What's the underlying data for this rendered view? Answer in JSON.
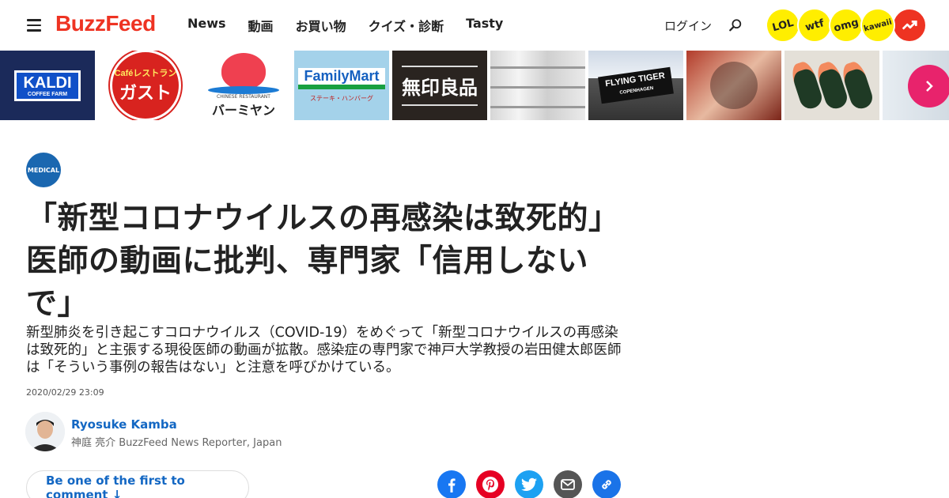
{
  "header": {
    "logo": "BuzzFeed",
    "nav": [
      "News",
      "動画",
      "お買い物",
      "クイズ・診断",
      "Tasty"
    ],
    "login": "ログイン",
    "badges": [
      "LOL",
      "wtf",
      "omg",
      "kawaii"
    ]
  },
  "strip": {
    "kaldi_main": "KALDI",
    "kaldi_sub": "COFFEE FARM",
    "gusto_small": "Caféレストラン",
    "gusto_big": "ガスト",
    "bamiyan_sub": "CHINESE RESTAURANT",
    "bamiyan_name": "バーミヤン",
    "familymart": "FamilyMart",
    "familymart_under": "ステーキ・ハンバーグ",
    "muji": "無印良品",
    "flying_tiger": "FLYING TIGER",
    "flying_tiger_sub": "COPENHAGEN"
  },
  "article": {
    "badge": "MEDICAL",
    "title": "「新型コロナウイルスの再感染は致死的」医師の動画に批判、専門家「信用しないで」",
    "description": "新型肺炎を引き起こすコロナウイルス（COVID-19）をめぐって「新型コロナウイルスの再感染は致死的」と主張する現役医師の動画が拡散。感染症の専門家で神戸大学教授の岩田健太郎医師は「そういう事例の報告はない」と注意を呼びかけている。",
    "date": "2020/02/29 23:09",
    "author_name": "Ryosuke Kamba",
    "author_role": "神庭 亮介 BuzzFeed News Reporter, Japan",
    "comment_label": "Be one of the first to comment ↓"
  },
  "colors": {
    "brand": "#ee3322",
    "link": "#1367c3",
    "badge_yellow": "#ffee00",
    "facebook": "#1877f2",
    "pinterest": "#e60023",
    "twitter": "#1da1f2",
    "email": "#555555",
    "copy_link": "#1a73e8"
  },
  "icons": [
    "menu-icon",
    "search-icon",
    "trending-icon",
    "chevron-right-icon",
    "facebook-icon",
    "pinterest-icon",
    "twitter-icon",
    "email-icon",
    "link-icon"
  ]
}
